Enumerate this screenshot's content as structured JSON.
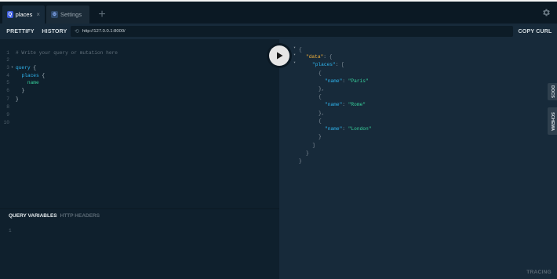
{
  "tabs": [
    {
      "icon": "Q",
      "label": "places",
      "close": "×"
    },
    {
      "icon": "⚙",
      "label": "Settings"
    }
  ],
  "add_tab_label": "+",
  "toolbar": {
    "prettify": "PRETTIFY",
    "history": "HISTORY",
    "url": "http://127.0.0.1:8000/",
    "copy_curl": "COPY CURL"
  },
  "editor": {
    "line_numbers": [
      "1",
      "2",
      "3",
      "4",
      "5",
      "6",
      "7",
      "8",
      "9",
      "10"
    ],
    "comment": "# Write your query or mutation here",
    "keyword": "query",
    "brace_open": " {",
    "field": "places",
    "field_brace": " {",
    "name": "name",
    "close_inner": "}",
    "close_outer": "}"
  },
  "variables": {
    "tab_query_variables": "QUERY VARIABLES",
    "tab_http_headers": "HTTP HEADERS",
    "line_number": "1"
  },
  "result": {
    "open_brace": "{",
    "data_key": "\"data\"",
    "colon_brace": ": {",
    "places_key": "\"places\"",
    "colon_bracket": ": [",
    "obj_open": "{",
    "obj_close": "},",
    "obj_close_last": "}",
    "name_key": "\"name\"",
    "colon": ": ",
    "places": [
      "\"Paris\"",
      "\"Rome\"",
      "\"London\""
    ],
    "bracket_close": "]",
    "data_close": "}",
    "root_close": "}"
  },
  "side_tabs": {
    "docs": "DOCS",
    "schema": "SCHEMA"
  },
  "footer": {
    "tracing": "TRACING"
  },
  "colors": {
    "accent": "#3b5bdb",
    "keyword": "#2fb5ef",
    "string": "#37d19c",
    "data_key": "#f0b03b"
  }
}
